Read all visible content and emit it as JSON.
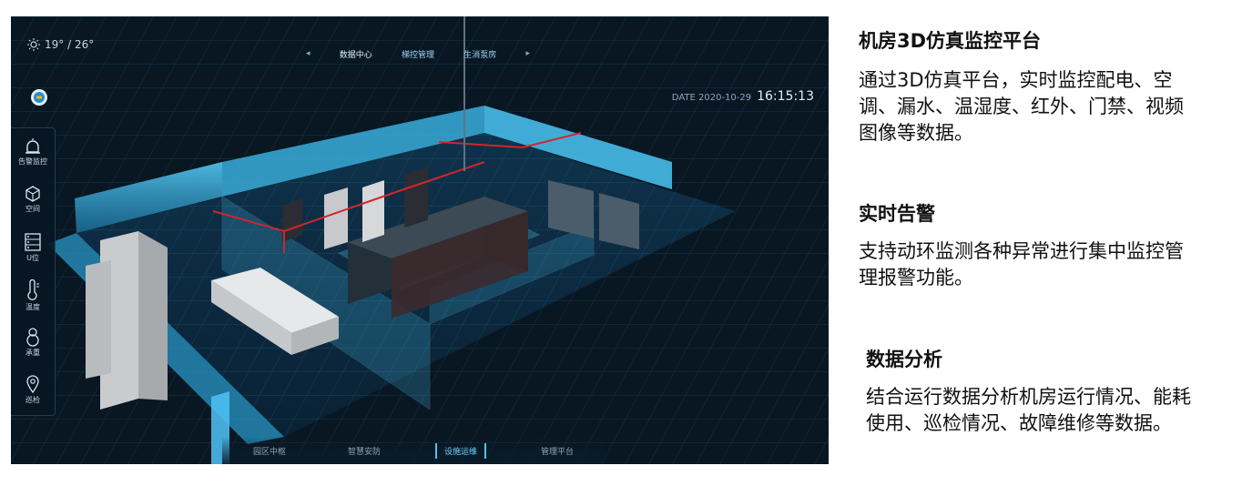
{
  "weather": {
    "icon": "sun-icon",
    "text": "19° / 26°"
  },
  "top_nav": {
    "tabs": [
      "数据中心",
      "梯控管理",
      "生消泵房"
    ]
  },
  "datetime": {
    "label": "DATE 2020-10-29",
    "time": "16:15:13"
  },
  "sidebar": {
    "items": [
      {
        "label": "告警监控",
        "icon": "alarm-icon"
      },
      {
        "label": "空间",
        "icon": "cube-icon"
      },
      {
        "label": "U位",
        "icon": "server-rack-icon"
      },
      {
        "label": "温度",
        "icon": "thermometer-icon"
      },
      {
        "label": "承重",
        "icon": "weight-icon"
      },
      {
        "label": "巡检",
        "icon": "location-pin-icon"
      }
    ]
  },
  "bottom_nav": {
    "tabs": [
      "园区中枢",
      "智慧安防",
      "设施运维",
      "管理平台"
    ],
    "active": "设施运维"
  },
  "colors": {
    "accent": "#4fc3f7",
    "room_bg": "#0a1520",
    "wall": "#3fb7e6",
    "alarm_line": "#d0262a"
  },
  "panel": {
    "sections": [
      {
        "title": "机房3D仿真监控平台",
        "body_lines": [
          "通过3D仿真平台，实时监控配电、空",
          "调、漏水、温湿度、红外、门禁、视频",
          "图像等数据。"
        ]
      },
      {
        "title": "实时告警",
        "body_lines": [
          "支持动环监测各种异常进行集中监控管",
          "理报警功能。"
        ]
      },
      {
        "title": "数据分析",
        "body_lines": [
          "结合运行数据分析机房运行情况、能耗",
          "使用、巡检情况、故障维修等数据。"
        ]
      }
    ]
  }
}
